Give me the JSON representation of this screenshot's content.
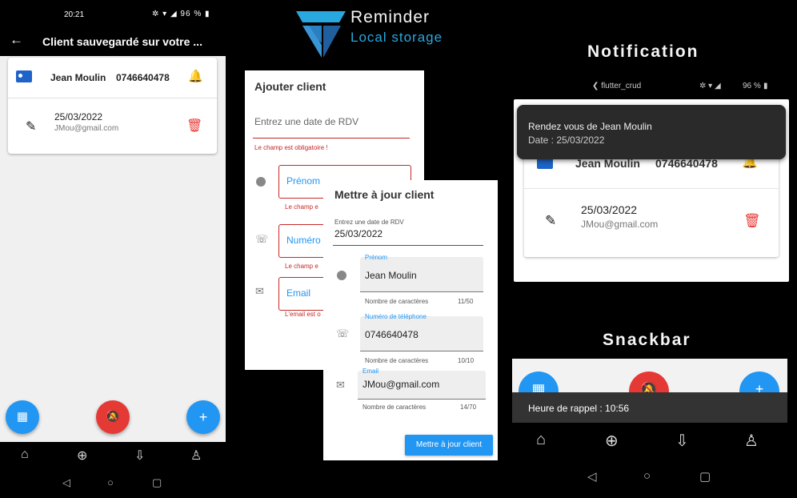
{
  "phone1": {
    "status_time": "20:21",
    "status_icons": "✲ ▾ ◢ 96 % ▮",
    "back_icon": "←",
    "title": "Client sauvegardé sur votre ...",
    "card": {
      "name": "Jean Moulin",
      "phone": "0746640478",
      "bell_plus_icon": "🔔",
      "date": "25/03/2022",
      "email": "JMou@gmail.com"
    },
    "fabs": {
      "calendar_icon": "▦",
      "bell_off_icon": "🔕",
      "add_icon": "+"
    },
    "bottom_nav": [
      "⌂",
      "⊕",
      "⇩",
      "♙"
    ],
    "system_nav": [
      "◁",
      "○",
      "▢"
    ]
  },
  "logo": {
    "title": "Reminder",
    "subtitle": "Local storage"
  },
  "add_form": {
    "title": "Ajouter client",
    "date_placeholder": "Entrez une date de RDV",
    "date_error": "Le champ est obligatoire !",
    "first_name_label": "Prénom",
    "first_name_error": "Le champ e",
    "number_label": "Numéro",
    "number_error": "Le champ e",
    "email_label": "Email",
    "email_error": "L'email est o"
  },
  "update_form": {
    "title": "Mettre à jour client",
    "date_label": "Entrez une date de RDV",
    "date_value": "25/03/2022",
    "first_name_label": "Prénom",
    "first_name_value": "Jean Moulin",
    "first_name_counter_label": "Nombre de caractères",
    "first_name_counter": "11/50",
    "phone_label": "Numéro de téléphone",
    "phone_value": "0746640478",
    "phone_counter_label": "Nombre de caractères",
    "phone_counter": "10/10",
    "email_label": "Email",
    "email_value": "JMou@gmail.com",
    "email_counter_label": "Nombre de caractères",
    "email_counter": "14/70",
    "submit_label": "Mettre à jour client"
  },
  "notification": {
    "heading": "Notification",
    "app_name": "flutter_crud",
    "battery": "96 %",
    "popup_title": "Rendez vous de Jean Moulin",
    "popup_body": "Date : 25/03/2022",
    "card_name": "Jean Moulin",
    "card_phone": "0746640478",
    "card_date": "25/03/2022",
    "card_email": "JMou@gmail.com"
  },
  "snackbar": {
    "heading": "Snackbar",
    "message": "Heure de rappel : 10:56"
  },
  "colors": {
    "primary_blue": "#2196f3",
    "error_red": "#c62828",
    "fab_red": "#e53935",
    "logo_blue": "#29a8e0"
  }
}
